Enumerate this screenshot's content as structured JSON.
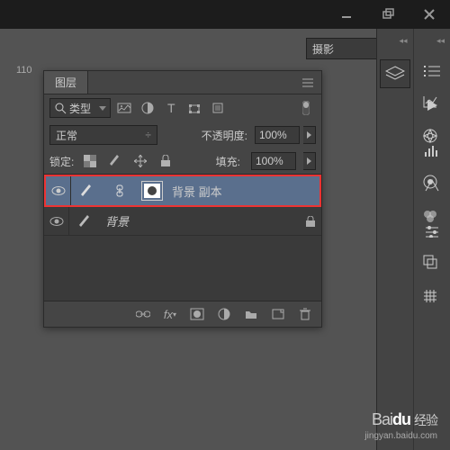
{
  "titlebar": {
    "min": "–",
    "max": "□",
    "close": "✕"
  },
  "workspace": {
    "selected": "摄影"
  },
  "ruler": {
    "mark": "110"
  },
  "layers_panel": {
    "tab": "图层",
    "filter_label": "类型",
    "blend_mode": "正常",
    "opacity_label": "不透明度:",
    "opacity_value": "100%",
    "lock_label": "锁定:",
    "fill_label": "填充:",
    "fill_value": "100%",
    "layers": [
      {
        "name": "背景 副本",
        "selected": true,
        "locked": false
      },
      {
        "name": "背景",
        "selected": false,
        "locked": true
      }
    ]
  },
  "watermark": {
    "brand_a": "Bai",
    "brand_b": "du",
    "brand_c": "经验",
    "url": "jingyan.baidu.com"
  }
}
